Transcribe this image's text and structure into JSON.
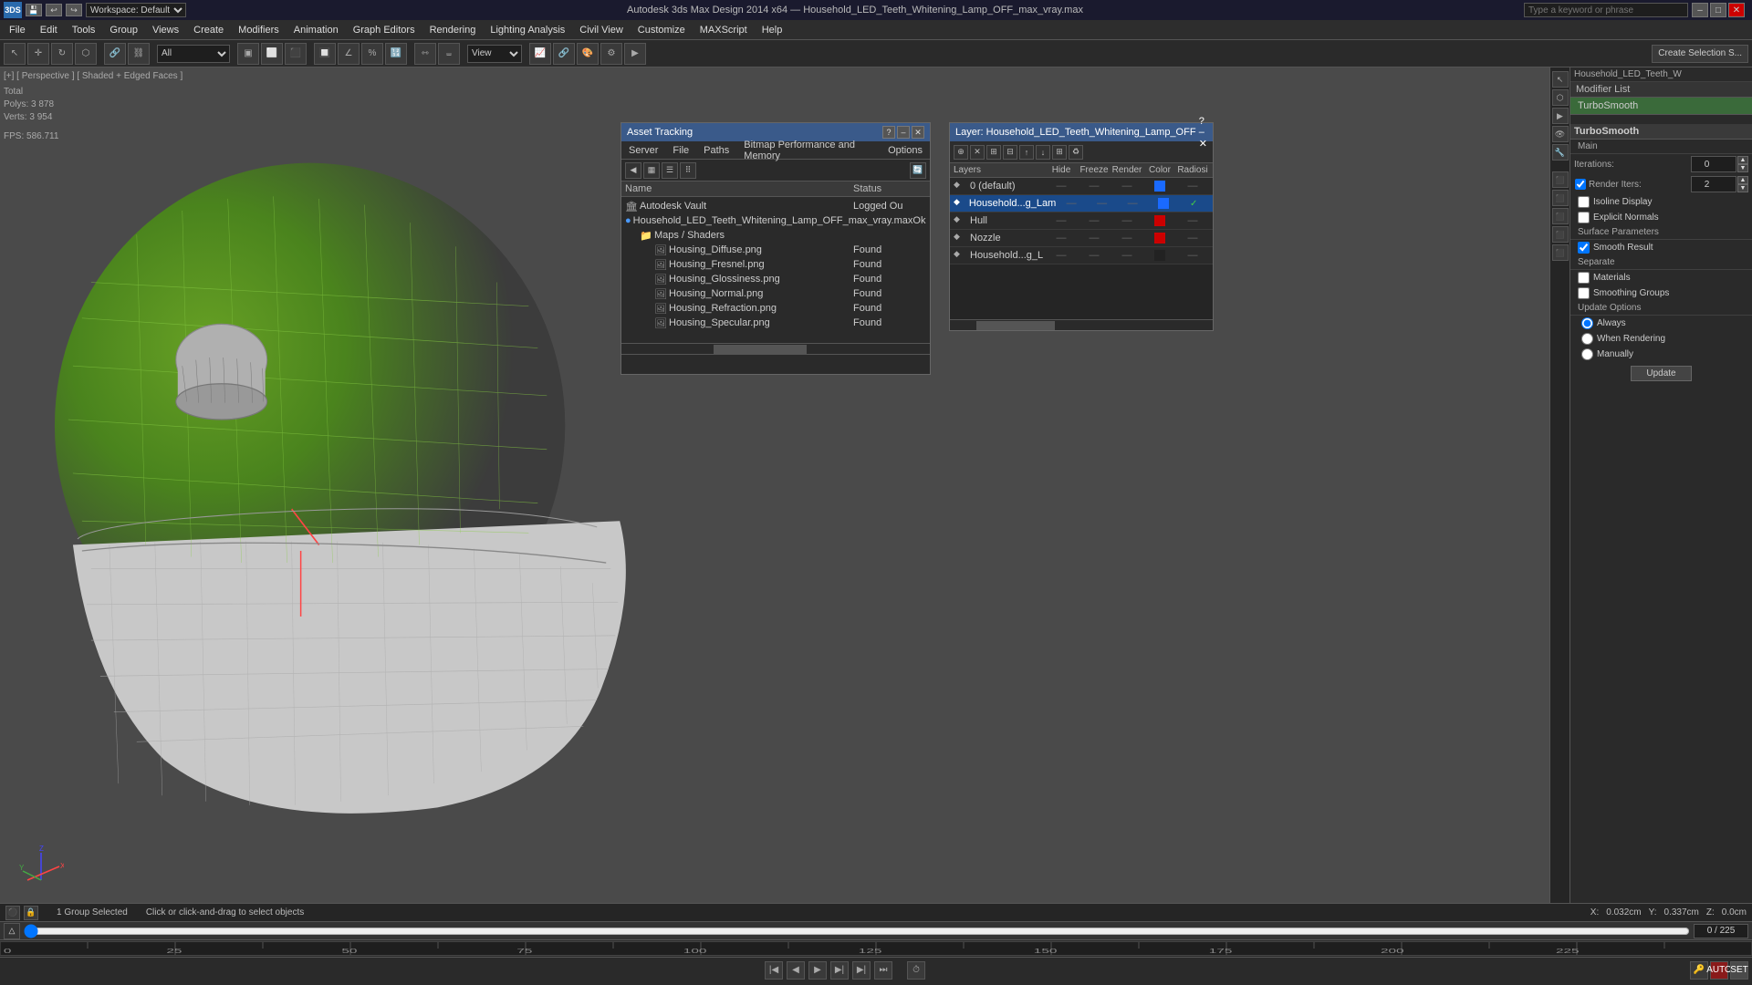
{
  "titlebar": {
    "title": "Autodesk 3ds Max Design 2014 x64 — Household_LED_Teeth_Whitening_Lamp_OFF_max_vray.max",
    "workspace": "Workspace: Default",
    "minimize": "–",
    "maximize": "□",
    "close": "✕",
    "search_placeholder": "Type a keyword or phrase"
  },
  "menubar": {
    "items": [
      "File",
      "Edit",
      "Tools",
      "Group",
      "Views",
      "Create",
      "Modifiers",
      "Animation",
      "Graph Editors",
      "Rendering",
      "Lighting Analysis",
      "Civil View",
      "Customize",
      "MAXScript",
      "Help"
    ]
  },
  "toolbar": {
    "view_label": "View",
    "shading_label": "Shaded + Edged Faces",
    "frame_label": "0 / 225",
    "create_selection": "Create Selection S..."
  },
  "viewport": {
    "label": "[+] [ Perspective ] [ Shaded + Edged Faces ]",
    "stats_polys_label": "Polys:",
    "stats_polys_total": "Total",
    "stats_polys_value": "3 878",
    "stats_verts_label": "Verts:",
    "stats_verts_value": "3 954",
    "fps_label": "FPS:",
    "fps_value": "586.711"
  },
  "asset_panel": {
    "title": "Asset Tracking",
    "menu": [
      "Server",
      "File",
      "Paths",
      "Bitmap Performance and Memory",
      "Options"
    ],
    "toolbar_icons": [
      "refresh",
      "folder-open",
      "grid",
      "grid-dots",
      "circle-info"
    ],
    "col_name": "Name",
    "col_status": "Status",
    "tree": [
      {
        "level": 0,
        "icon": "vault",
        "name": "Autodesk Vault",
        "status": "Logged Ou",
        "type": "vault"
      },
      {
        "level": 0,
        "icon": "file",
        "name": "Household_LED_Teeth_Whitening_Lamp_OFF_max_vray.max",
        "status": "Ok",
        "type": "file"
      },
      {
        "level": 1,
        "icon": "folder",
        "name": "Maps / Shaders",
        "status": "",
        "type": "folder"
      },
      {
        "level": 2,
        "icon": "image",
        "name": "Housing_Diffuse.png",
        "status": "Found",
        "type": "image"
      },
      {
        "level": 2,
        "icon": "image",
        "name": "Housing_Fresnel.png",
        "status": "Found",
        "type": "image"
      },
      {
        "level": 2,
        "icon": "image",
        "name": "Housing_Glossiness.png",
        "status": "Found",
        "type": "image"
      },
      {
        "level": 2,
        "icon": "image",
        "name": "Housing_Normal.png",
        "status": "Found",
        "type": "image"
      },
      {
        "level": 2,
        "icon": "image",
        "name": "Housing_Refraction.png",
        "status": "Found",
        "type": "image"
      },
      {
        "level": 2,
        "icon": "image",
        "name": "Housing_Specular.png",
        "status": "Found",
        "type": "image"
      }
    ]
  },
  "layers_panel": {
    "title": "Layer: Household_LED_Teeth_Whitening_Lamp_OFF",
    "col_layers": "Layers",
    "col_hide": "Hide",
    "col_freeze": "Freeze",
    "col_render": "Render",
    "col_color": "Color",
    "col_radiosity": "Radiosi",
    "layers": [
      {
        "name": "0 (default)",
        "hide": "—",
        "freeze": "—",
        "render": "—",
        "eye": true,
        "color": "#1a6aff",
        "radiosity": "—",
        "selected": false
      },
      {
        "name": "Household...g_Lam",
        "hide": "—",
        "freeze": "—",
        "render": "—",
        "eye": true,
        "color": "#1a6aff",
        "radiosity": "—",
        "selected": true,
        "checked": true
      },
      {
        "name": "Hull",
        "hide": "—",
        "freeze": "—",
        "render": "—",
        "eye": true,
        "color": "#cc0000",
        "radiosity": "—",
        "selected": false
      },
      {
        "name": "Nozzle",
        "hide": "—",
        "freeze": "—",
        "render": "—",
        "eye": true,
        "color": "#cc0000",
        "radiosity": "—",
        "selected": false
      },
      {
        "name": "Household...g_L",
        "hide": "—",
        "freeze": "—",
        "render": "—",
        "eye": true,
        "color": "#222222",
        "radiosity": "—",
        "selected": false
      }
    ]
  },
  "properties_panel": {
    "name_display": "Household_LED_Teeth_W",
    "modifier_list_label": "Modifier List",
    "modifier_items": [
      "TurboSmooth"
    ],
    "section_turbosmoooth": "TurboSmooth",
    "section_main": "Main",
    "iterations_label": "Iterations:",
    "iterations_value": "0",
    "render_iters_label": "Render Iters:",
    "render_iters_value": "2",
    "isoline_label": "Isoline Display",
    "explicit_normals_label": "Explicit Normals",
    "surface_params_label": "Surface Parameters",
    "smooth_result_label": "Smooth Result",
    "separate_label": "Separate",
    "materials_label": "Materials",
    "smoothing_groups_label": "Smoothing Groups",
    "update_options_label": "Update Options",
    "always_label": "Always",
    "when_rendering_label": "When Rendering",
    "manually_label": "Manually",
    "update_btn": "Update"
  },
  "status_bar": {
    "selection": "1 Group Selected",
    "hint": "Click or click-and-drag to select objects",
    "x_label": "X:",
    "x_value": "0.032cm",
    "y_label": "Y:",
    "y_value": "0.337cm",
    "z_label": "Z:",
    "z_value": "0.0cm"
  },
  "timeline": {
    "frame_current": "0",
    "frame_total": "225",
    "frame_label": "0 / 225"
  }
}
